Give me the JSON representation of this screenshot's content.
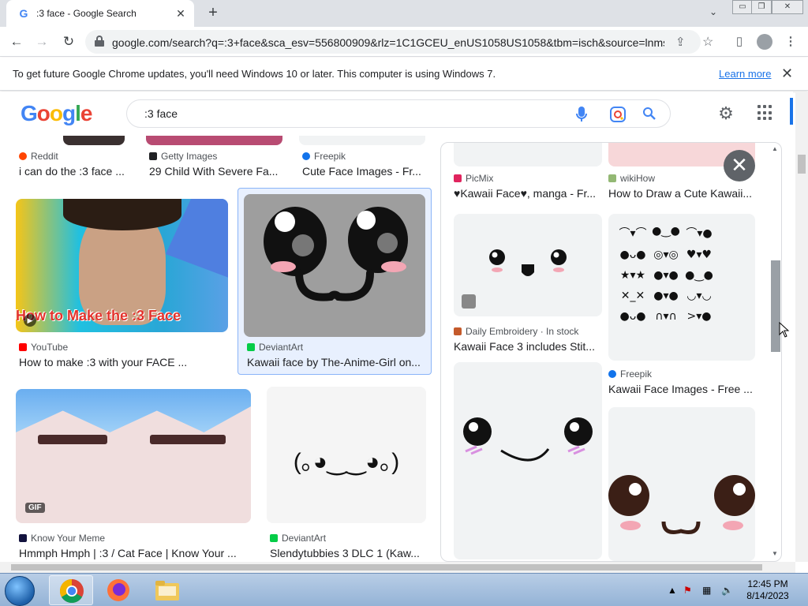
{
  "browser": {
    "tab_title": ":3 face - Google Search",
    "url": "google.com/search?q=:3+face&sca_esv=556800909&rlz=1C1GCEU_enUS1058US1058&tbm=isch&source=lnms..."
  },
  "infobar": {
    "message": "To get future Google Chrome updates, you'll need Windows 10 or later. This computer is using Windows 7.",
    "link": "Learn more"
  },
  "search": {
    "query": ":3 face"
  },
  "results": [
    {
      "source": "Reddit",
      "title": "i can do the :3 face ..."
    },
    {
      "source": "Getty Images",
      "title": "29 Child With Severe Fa..."
    },
    {
      "source": "Freepik",
      "title": "Cute Face Images - Fr..."
    },
    {
      "source": "YouTube",
      "title": "How to make :3 with your FACE ...",
      "overlay": "How to Make the :3 Face"
    },
    {
      "source": "DeviantArt",
      "title": "Kawaii face by The-Anime-Girl on..."
    },
    {
      "source": "Know Your Meme",
      "title": "Hmmph Hmph | :3 / Cat Face | Know Your ...",
      "badge": "GIF"
    },
    {
      "source": "DeviantArt",
      "title": "Slendytubbies 3 DLC 1 (Kaw...",
      "emoticon": "(｡◕‿‿◕｡)"
    }
  ],
  "panel": {
    "items": [
      {
        "source": "PicMix",
        "title": "♥Kawaii Face♥, manga - Fr..."
      },
      {
        "source": "wikiHow",
        "title": "How to Draw a Cute Kawaii..."
      },
      {
        "source": "Daily Embroidery · In stock",
        "title": "Kawaii Face 3 includes Stit..."
      },
      {
        "source": "Freepik",
        "title": "Kawaii Face Images - Free ..."
      }
    ]
  },
  "taskbar": {
    "time": "12:45 PM",
    "date": "8/14/2023"
  },
  "colors": {
    "link": "#1a73e8",
    "accent": "#1a73e8",
    "selected_bg": "#e8f0fe"
  }
}
